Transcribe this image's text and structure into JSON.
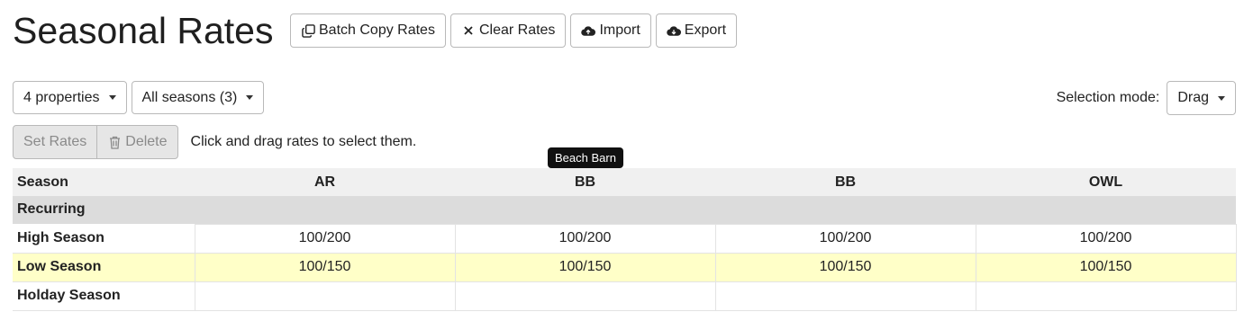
{
  "page": {
    "title": "Seasonal Rates"
  },
  "toolbar": {
    "batch_copy": "Batch Copy Rates",
    "clear": "Clear Rates",
    "import": "Import",
    "export": "Export"
  },
  "filters": {
    "properties": "4 properties",
    "seasons": "All seasons (3)"
  },
  "selection_mode": {
    "label": "Selection mode:",
    "value": "Drag"
  },
  "actions": {
    "set_rates": "Set Rates",
    "delete": "Delete",
    "hint": "Click and drag rates to select them."
  },
  "tooltip": {
    "text": "Beach Barn"
  },
  "table": {
    "columns": [
      "Season",
      "AR",
      "BB",
      "BB",
      "OWL"
    ],
    "group": "Recurring",
    "rows": [
      {
        "name": "High Season",
        "values": [
          "100/200",
          "100/200",
          "100/200",
          "100/200"
        ]
      },
      {
        "name": "Low Season",
        "values": [
          "100/150",
          "100/150",
          "100/150",
          "100/150"
        ]
      },
      {
        "name": "Holday Season",
        "values": [
          "",
          "",
          "",
          ""
        ]
      }
    ]
  },
  "colors": {
    "highlight_row": "#ffffc8",
    "header_bg": "#f0f0f0",
    "group_bg": "#dcdcdc",
    "disabled_bg": "#e6e6e6"
  },
  "icons": {
    "batch_copy": "copy-icon",
    "clear": "x-icon",
    "import": "cloud-upload-icon",
    "export": "cloud-download-icon",
    "delete": "trash-icon"
  }
}
